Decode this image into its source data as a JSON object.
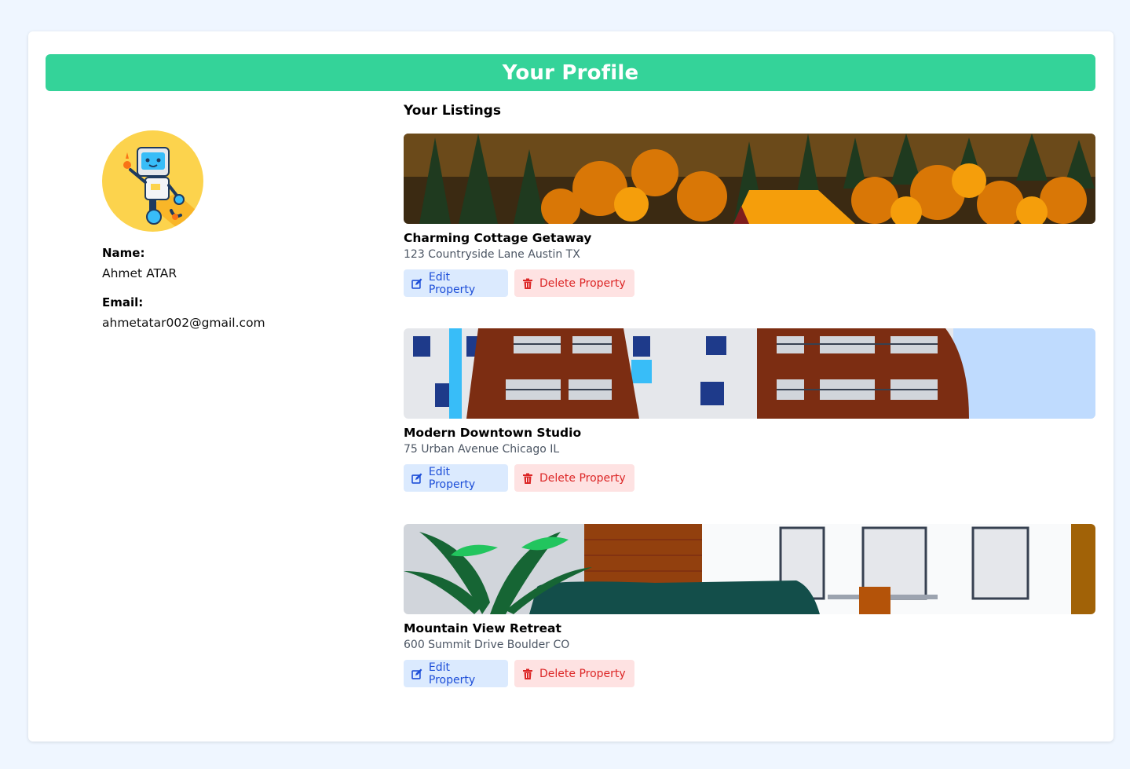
{
  "header": {
    "title": "Your Profile"
  },
  "profile": {
    "avatar_icon": "robot-avatar-icon",
    "name_label": "Name:",
    "name": "Ahmet ATAR",
    "email_label": "Email:",
    "email": "ahmetatar002@gmail.com"
  },
  "listings": {
    "title": "Your Listings",
    "items": [
      {
        "name": "Charming Cottage Getaway",
        "address": "123 Countryside Lane Austin TX",
        "edit_label": "Edit Property",
        "delete_label": "Delete Property"
      },
      {
        "name": "Modern Downtown Studio",
        "address": "75 Urban Avenue Chicago IL",
        "edit_label": "Edit Property",
        "delete_label": "Delete Property"
      },
      {
        "name": "Mountain View Retreat",
        "address": "600 Summit Drive Boulder CO",
        "edit_label": "Edit Property",
        "delete_label": "Delete Property"
      }
    ]
  },
  "colors": {
    "banner": "#34d399",
    "page_bg": "#eff6ff",
    "edit_bg": "#dbeafe",
    "edit_text": "#1d4ed8",
    "delete_bg": "#fee2e2",
    "delete_text": "#dc2626"
  },
  "icons": {
    "edit": "edit-icon",
    "delete": "trash-icon"
  }
}
